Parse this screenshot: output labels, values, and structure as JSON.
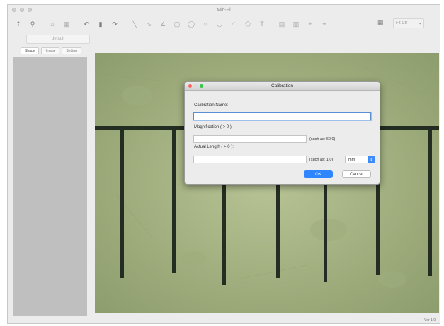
{
  "window": {
    "title": "Mic-Pi"
  },
  "toolbar": {
    "icons": [
      "pointer-icon",
      "pin-icon",
      "home-icon",
      "grid-icon",
      "undo-icon",
      "trash-icon",
      "redo-icon",
      "line-icon",
      "polyline-icon",
      "angle-icon",
      "rectangle-icon",
      "ellipse-icon",
      "circle-icon",
      "curve-icon",
      "arc-icon",
      "polygon-icon",
      "text-icon",
      "table-icon",
      "layout-icon",
      "plus-icon",
      "crosshair-icon"
    ],
    "zoom_label": "Fit Ctr",
    "panel_icon": "panel-icon"
  },
  "subtoolbar": {
    "default_label": "default"
  },
  "left_panel": {
    "tabs": [
      "Shape",
      "Image",
      "Setting"
    ]
  },
  "dialog": {
    "title": "Calibration",
    "name_label": "Calibration Name:",
    "name_value": "",
    "magnification_label": "Magnification ( > 0 ):",
    "magnification_value": "",
    "magnification_hint": "(such as: 60.0)",
    "length_label": "Actual Length ( > 0 ):",
    "length_value": "",
    "length_hint": "(such as: 1.0)",
    "unit_selected": "mm",
    "ok_label": "OK",
    "cancel_label": "Cancel"
  },
  "status": {
    "version": "Ver 1.0"
  },
  "colors": {
    "accent": "#2f86ff",
    "close": "#fc605c",
    "zoom": "#34c84a",
    "image_bg": "#aeb98a",
    "scale_line": "#232d22"
  }
}
